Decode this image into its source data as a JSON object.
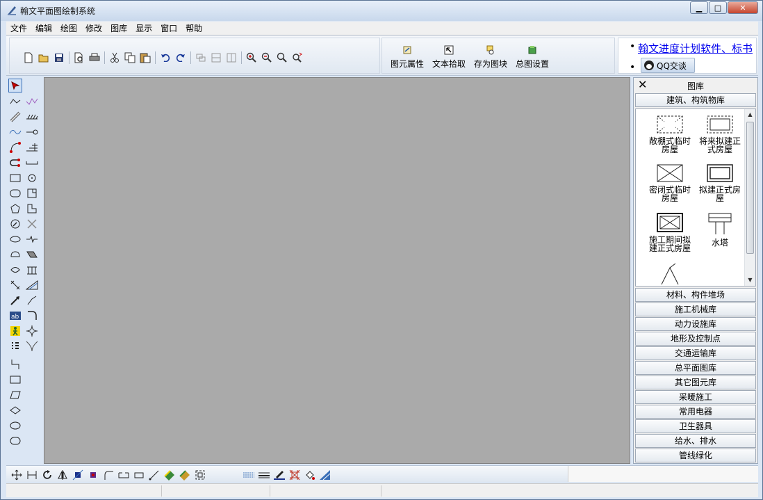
{
  "window": {
    "title": "翰文平面图绘制系统",
    "minimize_glyph": "▁",
    "maximize_glyph": "□",
    "close_glyph": "✕"
  },
  "menu": {
    "items": [
      "文件",
      "编辑",
      "绘图",
      "修改",
      "图库",
      "显示",
      "窗口",
      "帮助"
    ]
  },
  "toolbar": {
    "big_buttons": [
      {
        "label": "图元属性",
        "icon": "element-properties-icon"
      },
      {
        "label": "文本拾取",
        "icon": "text-pick-icon"
      },
      {
        "label": "存为图块",
        "icon": "save-block-icon"
      },
      {
        "label": "总图设置",
        "icon": "general-settings-icon"
      }
    ]
  },
  "ad_panel": {
    "link_text": "翰文进度计划软件、标书",
    "bullet": "•",
    "qq_button": "QQ交谈"
  },
  "library": {
    "close_glyph": "✕",
    "title": "图库",
    "active_category": "建筑、构筑物库",
    "items": [
      {
        "label": "敞棚式临时房屋"
      },
      {
        "label": "将来拟建正式房屋"
      },
      {
        "label": "密闭式临时房屋"
      },
      {
        "label": "拟建正式房屋"
      },
      {
        "label": "施工期间拟建正式房屋"
      },
      {
        "label": "水塔"
      }
    ],
    "categories": [
      "材料、构件堆场",
      "施工机械库",
      "动力设施库",
      "地形及控制点",
      "交通运输库",
      "总平面图库",
      "其它图元库",
      "采暖施工",
      "常用电器",
      "卫生器具",
      "给水、排水",
      "管线绿化"
    ]
  },
  "colors": {
    "canvas": "#aaaaaa",
    "chrome": "#dbe6f4",
    "link": "#0000ee"
  }
}
